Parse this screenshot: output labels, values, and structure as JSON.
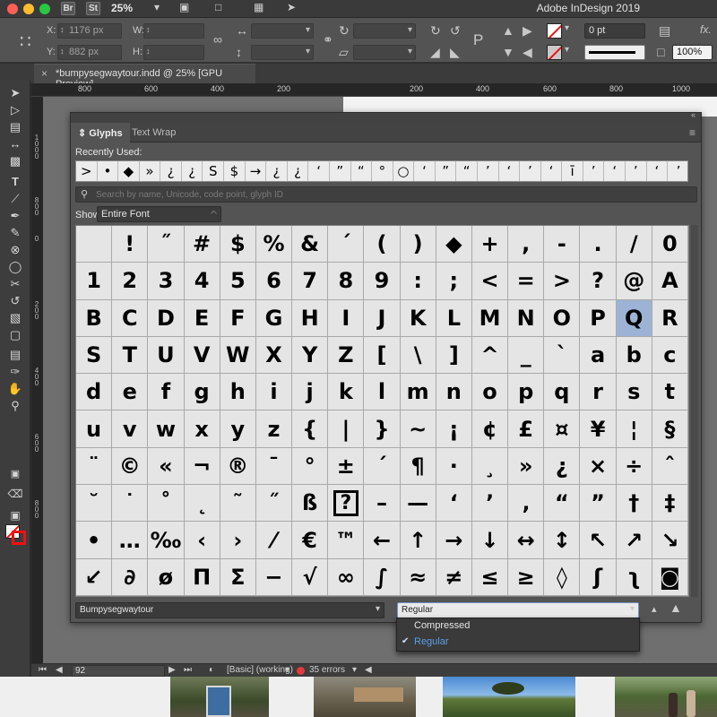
{
  "app": {
    "zoom": "25%",
    "title": "Adobe InDesign 2019",
    "bridge_badge": "Br",
    "stock_badge": "St"
  },
  "control_bar": {
    "x_label": "X:",
    "x_value": "1176 px",
    "y_label": "Y:",
    "y_value": "882 px",
    "w_label": "W:",
    "h_label": "H:",
    "stroke_weight": "0 pt",
    "scale_percent": "100%",
    "fx_label": "fx."
  },
  "document": {
    "tab_title": "*bumpysegwaytour.indd @ 25% [GPU Preview]",
    "close_glyph": "×"
  },
  "rulers": {
    "top_ticks": [
      "800",
      "600",
      "400",
      "200",
      "200",
      "400",
      "600",
      "800",
      "1000"
    ],
    "left_ticks": [
      "1000",
      "800",
      "0",
      "200",
      "400",
      "600",
      "800"
    ]
  },
  "panel": {
    "tabs": [
      "Glyphs",
      "Text Wrap"
    ],
    "active_tab": "Glyphs",
    "recently_used_label": "Recently Used:",
    "recently_used": [
      ">",
      "•",
      "◆",
      "»",
      "¿",
      "¿",
      "S",
      "$",
      "→",
      "¿",
      "¿",
      "‘",
      "”",
      "“",
      "°",
      "○",
      "‘",
      "”",
      "“",
      "’",
      "‘",
      "’",
      "‘",
      "ī",
      "’",
      "‘",
      "’",
      "‘",
      "’"
    ],
    "search_placeholder": "Search by name, Unicode, code point, glyph ID",
    "show_label": "Show:",
    "show_value": "Entire Font",
    "font_name": "Bumpysegwaytour",
    "font_style": "Regular",
    "selected_glyph": "Q",
    "style_menu": {
      "options": [
        "Compressed",
        "Regular"
      ],
      "checked": "Regular"
    },
    "glyph_rows": [
      [
        "",
        "!",
        "˝",
        "#",
        "$",
        "%",
        "&",
        "´",
        "(",
        ")",
        "◆",
        "+",
        ",",
        "-",
        ".",
        "/",
        "0"
      ],
      [
        "1",
        "2",
        "3",
        "4",
        "5",
        "6",
        "7",
        "8",
        "9",
        ":",
        ";",
        "<",
        "=",
        ">",
        "?",
        "@",
        "A"
      ],
      [
        "B",
        "C",
        "D",
        "E",
        "F",
        "G",
        "H",
        "I",
        "J",
        "K",
        "L",
        "M",
        "N",
        "O",
        "P",
        "Q",
        "R"
      ],
      [
        "S",
        "T",
        "U",
        "V",
        "W",
        "X",
        "Y",
        "Z",
        "[",
        "\\",
        "]",
        "^",
        "_",
        "`",
        "a",
        "b",
        "c"
      ],
      [
        "d",
        "e",
        "f",
        "g",
        "h",
        "i",
        "j",
        "k",
        "l",
        "m",
        "n",
        "o",
        "p",
        "q",
        "r",
        "s",
        "t"
      ],
      [
        "u",
        "v",
        "w",
        "x",
        "y",
        "z",
        "{",
        "|",
        "}",
        "~",
        "¡",
        "¢",
        "£",
        "¤",
        "¥",
        "¦",
        "§"
      ],
      [
        "¨",
        "©",
        "«",
        "¬",
        "®",
        "¯",
        "°",
        "±",
        "´",
        "¶",
        "·",
        "¸",
        "»",
        "¿",
        "×",
        "÷",
        "ˆ"
      ],
      [
        "˘",
        "˙",
        "˚",
        "˛",
        "˜",
        "˝",
        "ß",
        "?",
        "–",
        "—",
        "‘",
        "’",
        "‚",
        "“",
        "”",
        "†",
        "‡"
      ],
      [
        "•",
        "…",
        "‰",
        "‹",
        "›",
        "⁄",
        "€",
        "™",
        "←",
        "↑",
        "→",
        "↓",
        "↔",
        "↕",
        "↖",
        "↗",
        "↘"
      ],
      [
        "↙",
        "∂",
        "ø",
        "Π",
        "Σ",
        "−",
        "√",
        "∞",
        "∫",
        "≈",
        "≠",
        "≤",
        "≥",
        "◊",
        "ʃ",
        "ʅ",
        "◙"
      ]
    ]
  },
  "status_bar": {
    "page": "92",
    "style": "[Basic] (working)",
    "errors": "35 errors"
  },
  "colors": {
    "selected_glyph_bg": "#9db3d5",
    "preflight_error": "#e23b3b",
    "menu_highlight_text": "#5aa0e8"
  }
}
